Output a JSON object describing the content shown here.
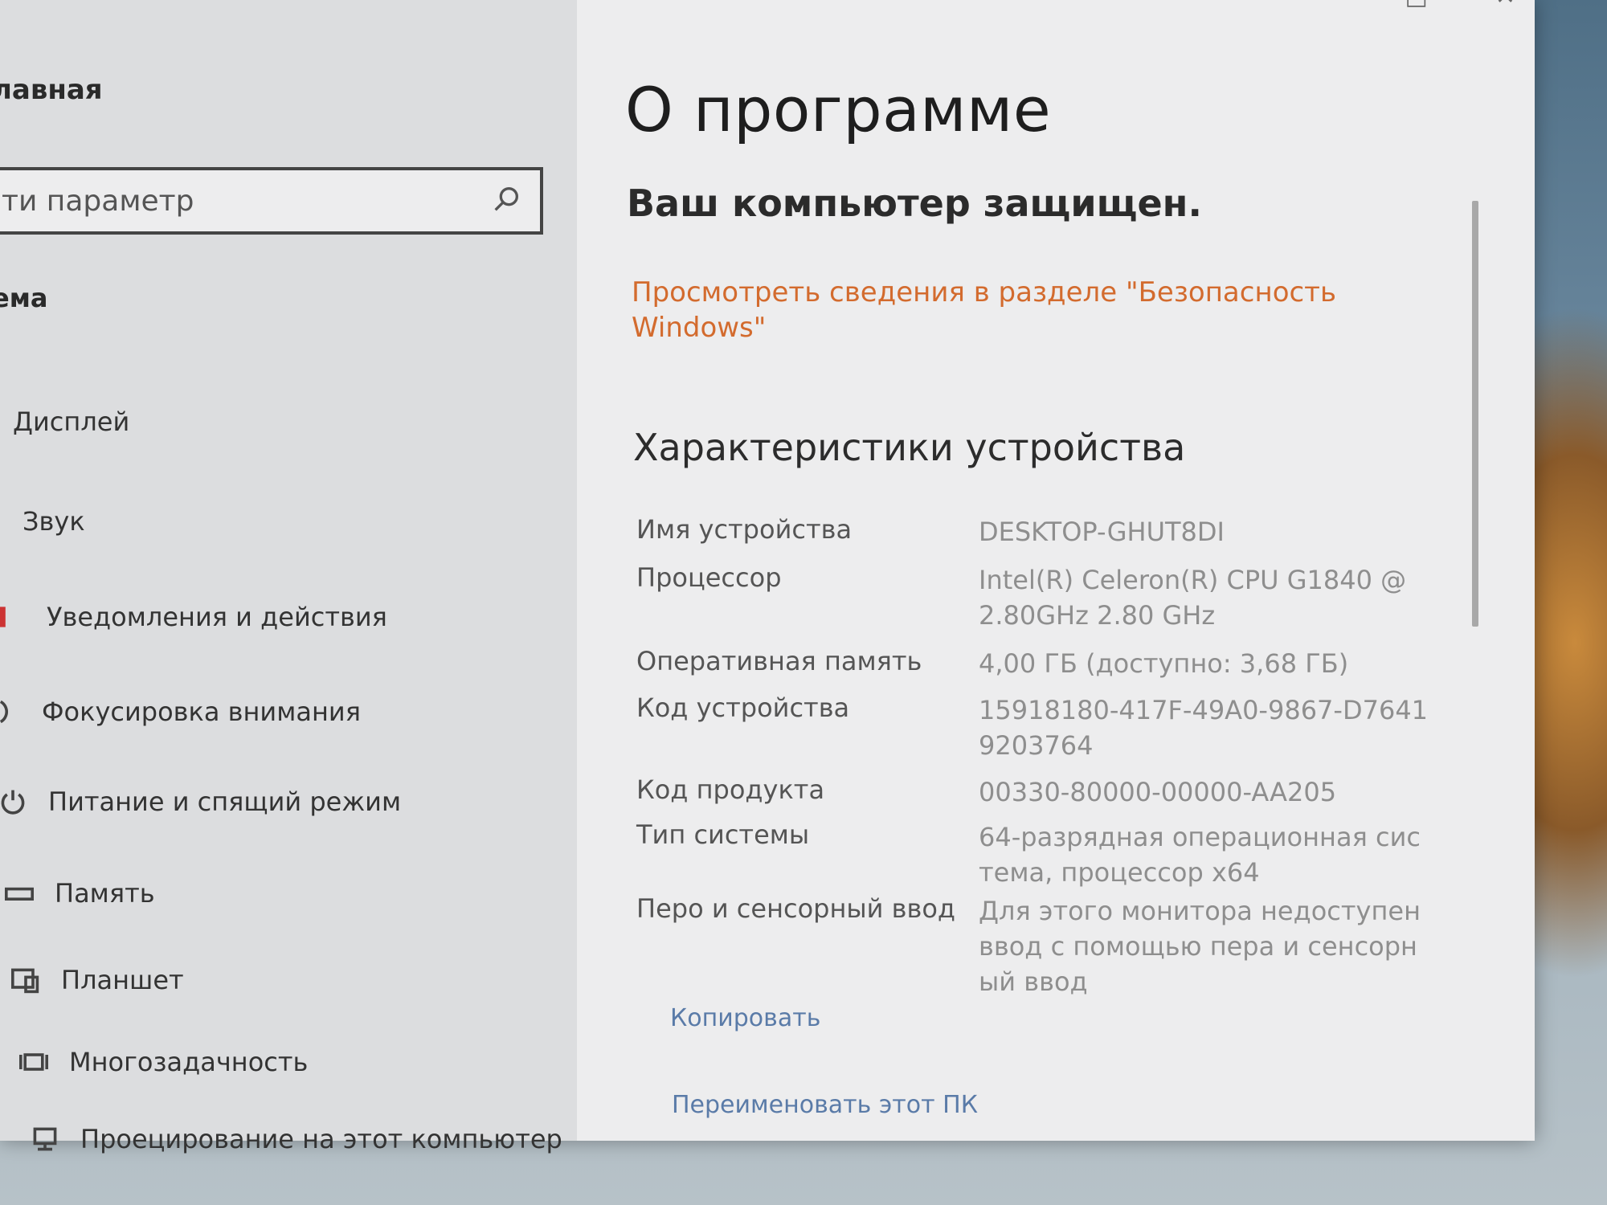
{
  "sidebar": {
    "home_label": "лавная",
    "search": {
      "value": "ти параметр",
      "icon": "search-icon"
    },
    "section_label": "ема",
    "items": [
      {
        "label": "Дисплей",
        "icon": "display-icon"
      },
      {
        "label": "Звук",
        "icon": "sound-icon"
      },
      {
        "label": "Уведомления и действия",
        "icon": "notifications-icon"
      },
      {
        "label": "Фокусировка внимания",
        "icon": "focus-assist-icon"
      },
      {
        "label": "Питание и спящий режим",
        "icon": "power-icon"
      },
      {
        "label": "Память",
        "icon": "storage-icon"
      },
      {
        "label": "Планшет",
        "icon": "tablet-icon"
      },
      {
        "label": "Многозадачность",
        "icon": "multitasking-icon"
      },
      {
        "label": "Проецирование на этот компьютер",
        "icon": "projecting-icon"
      }
    ]
  },
  "main": {
    "title": "О программе",
    "protect_heading": "Ваш компьютер защищен.",
    "security_link": "Просмотреть сведения в разделе \"Безопасность Windows\"",
    "specs_heading": "Характеристики устройства",
    "specs": [
      {
        "label": "Имя устройства",
        "value": "DESKTOP-GHUT8DI"
      },
      {
        "label": "Процессор",
        "value": "Intel(R) Celeron(R) CPU G1840 @ 2.80GHz   2.80 GHz"
      },
      {
        "label": "Оперативная память",
        "value": "4,00 ГБ (доступно: 3,68 ГБ)"
      },
      {
        "label": "Код устройства",
        "value": "15918180-417F-49A0-9867-D76419203764"
      },
      {
        "label": "Код продукта",
        "value": "00330-80000-00000-AA205"
      },
      {
        "label": "Тип системы",
        "value": "64-разрядная операционная система, процессор x64"
      },
      {
        "label": "Перо и сенсорный ввод",
        "value": "Для этого монитора недоступен ввод с помощью пера и сенсорный ввод"
      }
    ],
    "copy_label": "Копировать",
    "rename_label": "Переименовать этот ПК"
  },
  "window_controls": {
    "maximize_icon": "maximize-icon",
    "close_icon": "close-icon"
  },
  "colors": {
    "link": "#d36b2e",
    "action": "#5a7ba8"
  }
}
